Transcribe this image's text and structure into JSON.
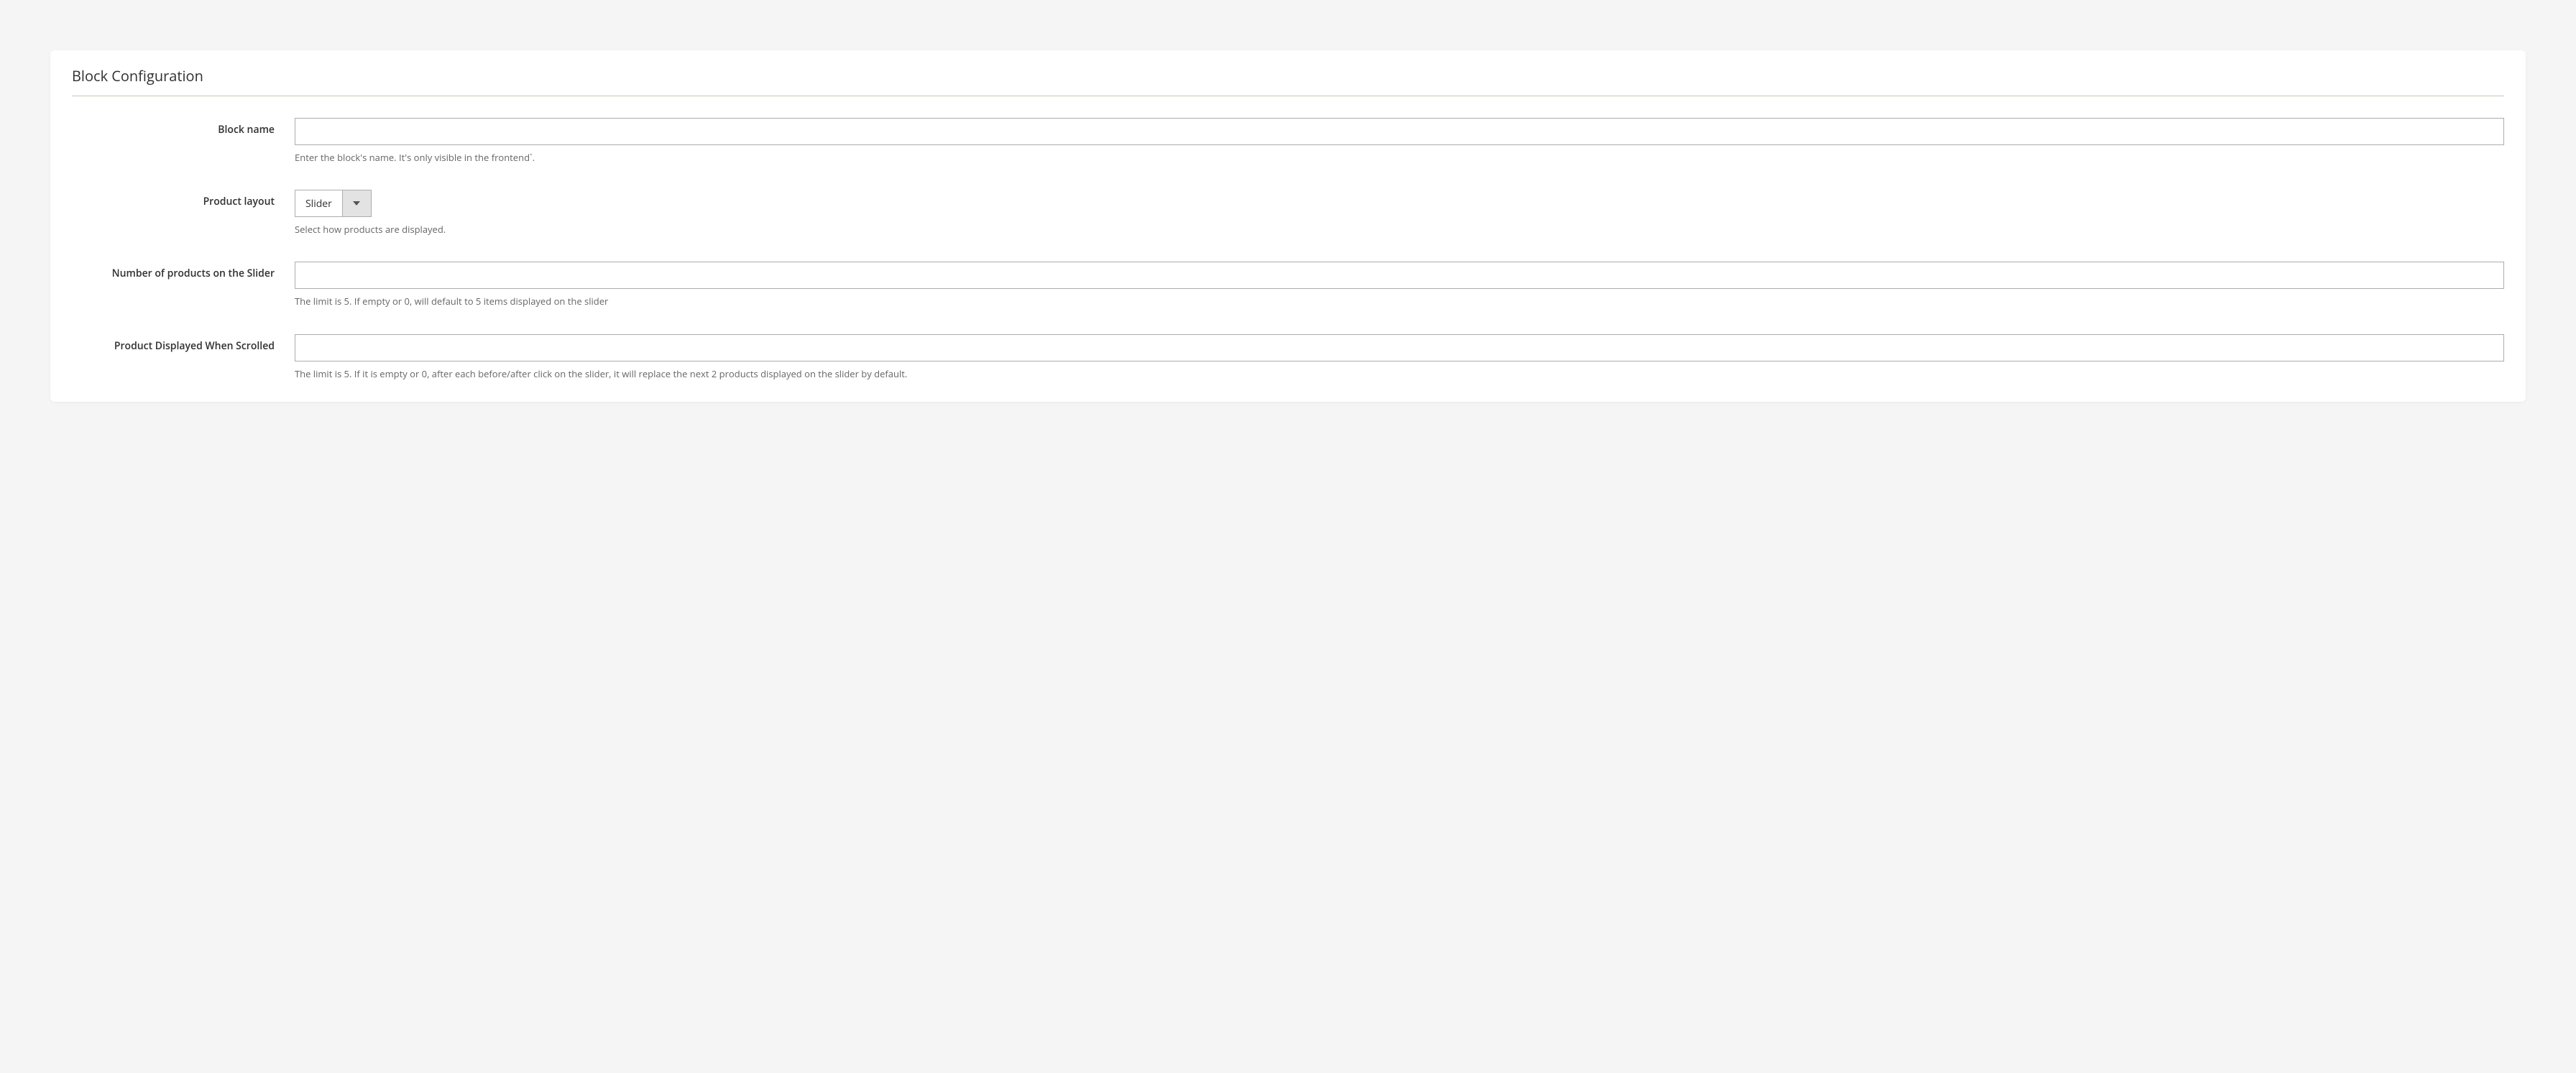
{
  "panel": {
    "title": "Block Configuration"
  },
  "fields": {
    "block_name": {
      "label": "Block name",
      "value": "",
      "note": "Enter the block's name. It's only visible in the frontend`."
    },
    "product_layout": {
      "label": "Product layout",
      "value": "Slider",
      "note": "Select how products are displayed."
    },
    "num_products": {
      "label": "Number of products on the Slider",
      "value": "",
      "note": "The limit is 5. If empty or 0, will default to 5 items displayed on the slider"
    },
    "scroll_products": {
      "label": "Product Displayed When Scrolled",
      "value": "",
      "note": "The limit is 5. If it is empty or 0, after each before/after click on the slider, it will replace the next 2 products displayed on the slider by default."
    }
  }
}
